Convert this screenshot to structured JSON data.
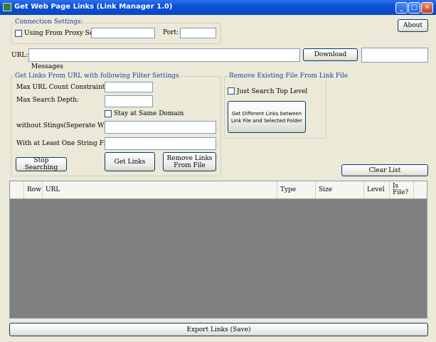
{
  "window": {
    "title": "Get Web Page Links (Link Manager 1.0)"
  },
  "connection": {
    "legend": "Connection Settings:",
    "proxy_label": "Using From Proxy Server",
    "proxy_value": "",
    "port_label": "Port:",
    "port_value": ""
  },
  "about_label": "About",
  "url": {
    "label": "URL:",
    "value": ""
  },
  "download_label": "Download",
  "messages_label": "Messages",
  "filter": {
    "legend": "Get Links From URL with following Filter Settings",
    "max_count_label": "Max URL Count Constraint:",
    "max_depth_label": "Max Search Depth:",
    "same_domain_label": "Stay at Same Domain",
    "without_label": "without Stings(Seperate With /):",
    "with_label": "With at Least One String From:",
    "stop_label": "Stop Searching",
    "get_links_label": "Get Links",
    "remove_links_label": "Remove Links From File"
  },
  "remove": {
    "legend": "Remove Existing File From Link File",
    "top_level_label": "Just Search Top Level",
    "diff_label": "Get Different Links between Link File and Selected Folder"
  },
  "clear_label": "Clear List",
  "grid": {
    "columns": [
      "Row",
      "URL",
      "Type",
      "Size",
      "Level",
      "Is File?"
    ]
  },
  "export_label": "Export Links (Save)"
}
